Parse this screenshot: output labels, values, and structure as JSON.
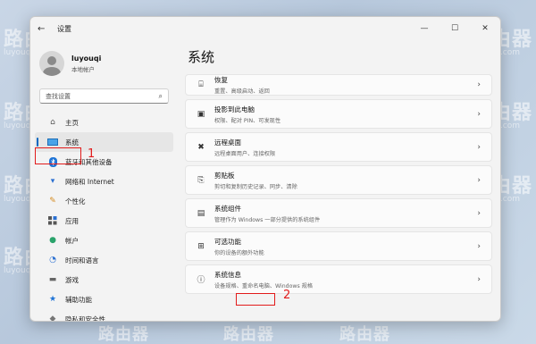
{
  "watermark": {
    "text": "路由器",
    "domain": "luyouqi.com"
  },
  "window": {
    "title": "设置",
    "back": "←",
    "min": "—",
    "max": "☐",
    "close": "✕"
  },
  "profile": {
    "name": "luyouqi",
    "account": "本地帐户"
  },
  "search": {
    "placeholder": "查找设置",
    "icon": "search-icon"
  },
  "nav": [
    {
      "label": "主页",
      "icon": "home-icon"
    },
    {
      "label": "系统",
      "icon": "monitor-icon",
      "active": true
    },
    {
      "label": "蓝牙和其他设备",
      "icon": "bluetooth-icon"
    },
    {
      "label": "网络和 Internet",
      "icon": "wifi-icon"
    },
    {
      "label": "个性化",
      "icon": "brush-icon"
    },
    {
      "label": "应用",
      "icon": "apps-icon"
    },
    {
      "label": "帐户",
      "icon": "person-icon"
    },
    {
      "label": "时间和语言",
      "icon": "globe-clock-icon"
    },
    {
      "label": "游戏",
      "icon": "gamepad-icon"
    },
    {
      "label": "辅助功能",
      "icon": "accessibility-icon"
    },
    {
      "label": "隐私和安全性",
      "icon": "shield-icon"
    }
  ],
  "main": {
    "title": "系统",
    "cards": [
      {
        "title": "恢复",
        "desc": "重置、高级启动、返回",
        "icon": "recovery-icon"
      },
      {
        "title": "投影到此电脑",
        "desc": "权限、配对 PIN、可发现性",
        "icon": "projection-icon"
      },
      {
        "title": "远程桌面",
        "desc": "远程桌面用户、连接权限",
        "icon": "remote-desktop-icon"
      },
      {
        "title": "剪贴板",
        "desc": "剪切和复制历史记录、同步、清除",
        "icon": "clipboard-icon"
      },
      {
        "title": "系统组件",
        "desc": "管理作为 Windows 一部分提供的系统组件",
        "icon": "components-icon"
      },
      {
        "title": "可选功能",
        "desc": "你的设备的额外功能",
        "icon": "optional-features-icon"
      },
      {
        "title": "系统信息",
        "desc": "设备规格、重命名电脑、Windows 规格",
        "icon": "info-icon"
      }
    ]
  },
  "annotations": {
    "label1": "1",
    "label2": "2",
    "color": "#e21b1b"
  },
  "accent": "#0067c0"
}
